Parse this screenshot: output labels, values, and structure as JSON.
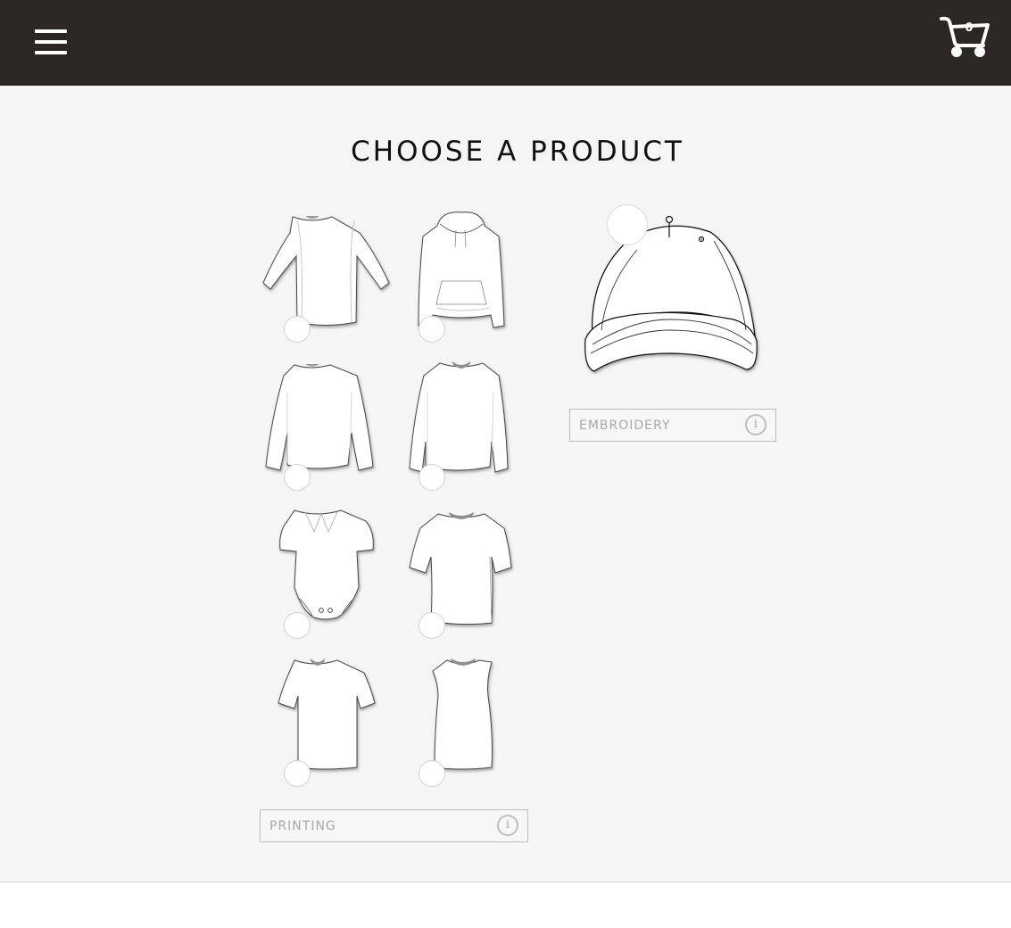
{
  "header": {
    "menu_icon": "hamburger-menu-icon",
    "cart_icon": "shopping-cart-icon",
    "cart_count": "0",
    "colors": {
      "bar": "#2b2722",
      "icons": "#ffffff"
    }
  },
  "page": {
    "title": "CHOOSE A PRODUCT",
    "background": "#f5f5f5"
  },
  "printing": {
    "label": "PRINTING",
    "info_icon": "info-icon",
    "info_glyph": "i",
    "products": [
      {
        "id": "raglan-shirt",
        "icon": "raglan-shirt-icon"
      },
      {
        "id": "hoodie",
        "icon": "hoodie-icon"
      },
      {
        "id": "long-sleeve-shirt",
        "icon": "long-sleeve-shirt-icon"
      },
      {
        "id": "sweatshirt",
        "icon": "sweatshirt-icon"
      },
      {
        "id": "baby-bodysuit",
        "icon": "baby-bodysuit-icon"
      },
      {
        "id": "womens-tee",
        "icon": "womens-tee-icon"
      },
      {
        "id": "t-shirt",
        "icon": "t-shirt-icon"
      },
      {
        "id": "tank-top",
        "icon": "tank-top-icon"
      }
    ]
  },
  "embroidery": {
    "label": "EMBROIDERY",
    "info_icon": "info-icon",
    "info_glyph": "i",
    "products": [
      {
        "id": "cap",
        "icon": "baseball-cap-icon"
      }
    ]
  }
}
